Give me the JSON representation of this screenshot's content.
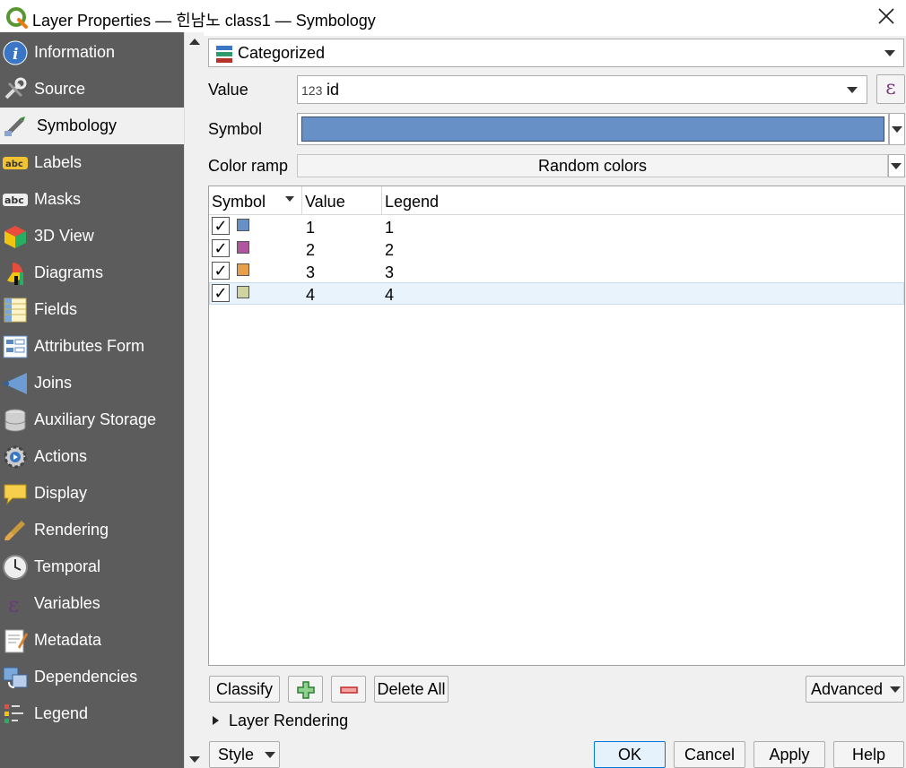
{
  "window": {
    "title": "Layer Properties — 힌남노 class1 — Symbology"
  },
  "search": {
    "placeholder": ""
  },
  "nav": {
    "items": [
      {
        "label": "Information",
        "icon": "info-icon",
        "selected": false
      },
      {
        "label": "Source",
        "icon": "source-wrench-icon",
        "selected": false
      },
      {
        "label": "Symbology",
        "icon": "paintbrush-icon",
        "selected": true
      },
      {
        "label": "Labels",
        "icon": "labels-abc-icon",
        "selected": false
      },
      {
        "label": "Masks",
        "icon": "masks-abc-icon",
        "selected": false
      },
      {
        "label": "3D View",
        "icon": "cube-icon",
        "selected": false
      },
      {
        "label": "Diagrams",
        "icon": "diagram-icon",
        "selected": false
      },
      {
        "label": "Fields",
        "icon": "fields-icon",
        "selected": false
      },
      {
        "label": "Attributes Form",
        "icon": "form-icon",
        "selected": false
      },
      {
        "label": "Joins",
        "icon": "joins-icon",
        "selected": false
      },
      {
        "label": "Auxiliary Storage",
        "icon": "database-icon",
        "selected": false
      },
      {
        "label": "Actions",
        "icon": "actions-gear-icon",
        "selected": false
      },
      {
        "label": "Display",
        "icon": "speech-bubble-icon",
        "selected": false
      },
      {
        "label": "Rendering",
        "icon": "brush-icon",
        "selected": false
      },
      {
        "label": "Temporal",
        "icon": "clock-icon",
        "selected": false
      },
      {
        "label": "Variables",
        "icon": "epsilon-icon",
        "selected": false
      },
      {
        "label": "Metadata",
        "icon": "metadata-icon",
        "selected": false
      },
      {
        "label": "Dependencies",
        "icon": "dependencies-icon",
        "selected": false
      },
      {
        "label": "Legend",
        "icon": "legend-icon",
        "selected": false
      }
    ]
  },
  "symbology": {
    "renderer": "Categorized",
    "value_label": "Value",
    "value_type": "123",
    "value_field": "id",
    "symbol_label": "Symbol",
    "symbol_color": "#6690c6",
    "color_ramp_label": "Color ramp",
    "color_ramp": "Random colors"
  },
  "table": {
    "headers": {
      "symbol": "Symbol",
      "value": "Value",
      "legend": "Legend"
    },
    "rows": [
      {
        "checked": true,
        "color": "#6690c6",
        "value": "1",
        "legend": "1"
      },
      {
        "checked": true,
        "color": "#b0569e",
        "value": "2",
        "legend": "2"
      },
      {
        "checked": true,
        "color": "#e6a04c",
        "value": "3",
        "legend": "3"
      },
      {
        "checked": true,
        "color": "#cfd2a1",
        "value": "4",
        "legend": "4"
      }
    ],
    "check_glyph": "✓"
  },
  "actions": {
    "classify": "Classify",
    "delete_all": "Delete All",
    "advanced": "Advanced"
  },
  "layer_rendering": "Layer Rendering",
  "footer": {
    "style": "Style",
    "ok": "OK",
    "cancel": "Cancel",
    "apply": "Apply",
    "help": "Help"
  },
  "expression_glyph": "ε"
}
